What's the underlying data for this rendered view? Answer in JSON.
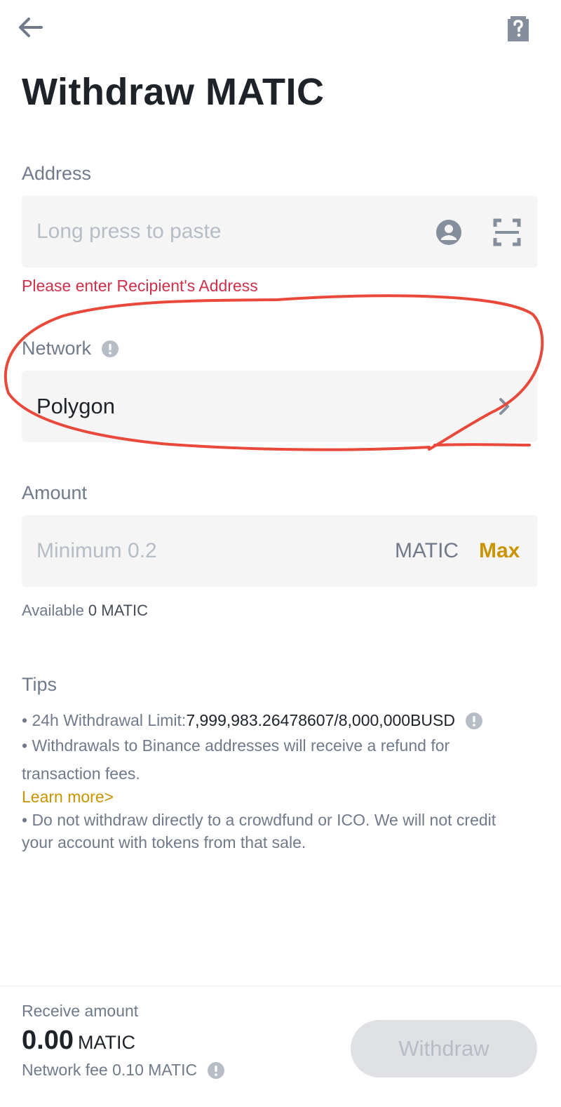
{
  "page": {
    "title": "Withdraw MATIC"
  },
  "icons": {
    "back": "arrow-left-icon",
    "help": "help-doc-icon",
    "contact": "address-book-icon",
    "scan": "qr-scan-icon",
    "chevron": "chevron-right-icon",
    "info": "info-icon"
  },
  "address": {
    "label": "Address",
    "placeholder": "Long press to paste",
    "error": "Please enter Recipient's Address"
  },
  "network": {
    "label": "Network",
    "value": "Polygon"
  },
  "amount": {
    "label": "Amount",
    "placeholder": "Minimum 0.2",
    "unit": "MATIC",
    "max_label": "Max"
  },
  "available": {
    "label": "Available",
    "value": "0 MATIC"
  },
  "tips": {
    "title": "Tips",
    "limit_label": "• 24h Withdrawal Limit: ",
    "limit_value": "7,999,983.26478607/8,000,000BUSD",
    "refund_line1": "• Withdrawals to Binance addresses will receive a refund for",
    "refund_line2": "transaction fees.",
    "learn_more": "Learn more>",
    "ico_line1": "• Do not withdraw directly to a crowdfund or ICO. We will not credit",
    "ico_line2": "your account with tokens from that sale."
  },
  "footer": {
    "receive_label": "Receive amount",
    "receive_value": "0.00",
    "receive_unit": "MATIC",
    "fee_text": "Network fee 0.10 MATIC",
    "withdraw_label": "Withdraw"
  },
  "colors": {
    "accent": "#c99400",
    "error": "#cf304a",
    "annotation": "#e8493a",
    "field_bg": "#f5f5f5"
  }
}
